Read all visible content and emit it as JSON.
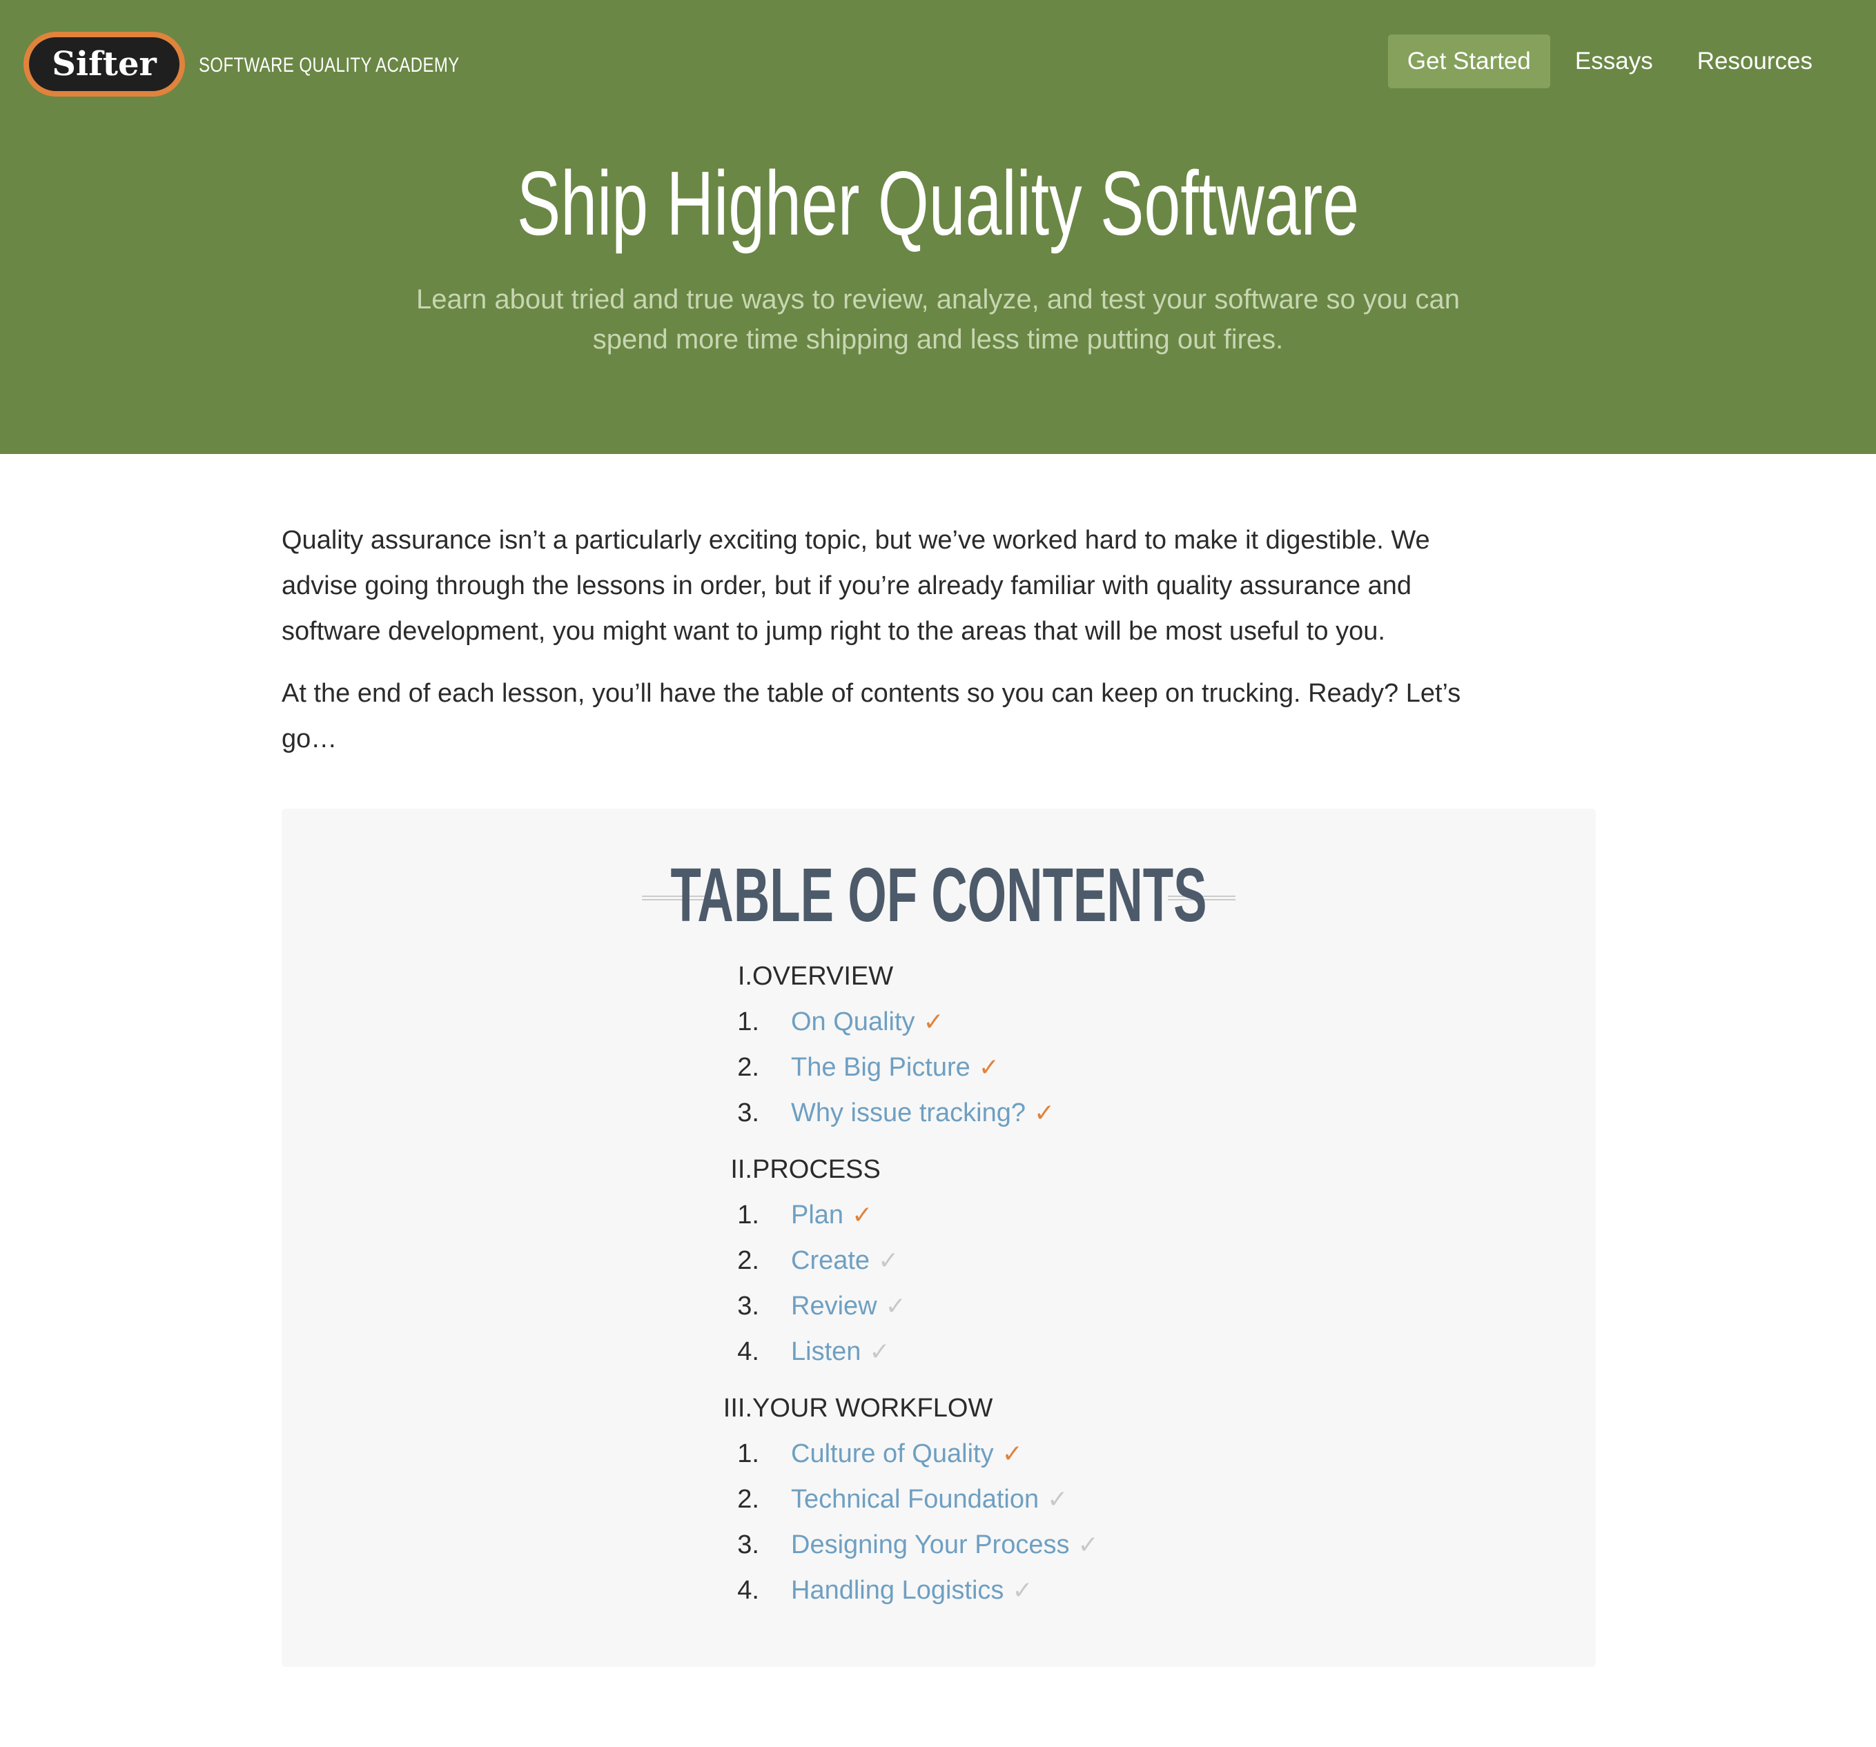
{
  "header": {
    "logo_text": "Sifter",
    "academy_text": "SOFTWARE QUALITY ACADEMY",
    "nav": [
      {
        "label": "Get Started",
        "active": true
      },
      {
        "label": "Essays",
        "active": false
      },
      {
        "label": "Resources",
        "active": false
      }
    ],
    "title": "Ship Higher Quality Software",
    "subtitle_line1": "Learn about tried and true ways to review, analyze, and test your software so you can",
    "subtitle_line2": "spend more time shipping and less time putting out fires."
  },
  "intro": {
    "para1_line1": "Quality assurance isn’t a particularly exciting topic, but we’ve worked hard to make it digestible. We",
    "para1_line2": "advise going through the lessons in order, but if you’re already familiar with quality assurance and",
    "para1_line3": "software development, you might want to jump right to the areas that will be most useful to you.",
    "para2_line1": "At the end of each lesson, you’ll have the table of contents so you can keep on trucking. Ready? Let’s",
    "para2_line2": "go…"
  },
  "toc": {
    "title": "TABLE OF CONTENTS",
    "check_glyph": "✓",
    "sections": [
      {
        "numeral": "I.",
        "title": "OVERVIEW",
        "items": [
          {
            "num": "1.",
            "label": "On Quality",
            "done": true
          },
          {
            "num": "2.",
            "label": "The Big Picture",
            "done": true
          },
          {
            "num": "3.",
            "label": "Why issue tracking?",
            "done": true
          }
        ]
      },
      {
        "numeral": "II.",
        "title": "PROCESS",
        "items": [
          {
            "num": "1.",
            "label": "Plan",
            "done": true
          },
          {
            "num": "2.",
            "label": "Create",
            "done": false
          },
          {
            "num": "3.",
            "label": "Review",
            "done": false
          },
          {
            "num": "4.",
            "label": "Listen",
            "done": false
          }
        ]
      },
      {
        "numeral": "III.",
        "title": "YOUR WORKFLOW",
        "items": [
          {
            "num": "1.",
            "label": "Culture of Quality",
            "done": true
          },
          {
            "num": "2.",
            "label": "Technical Foundation",
            "done": false
          },
          {
            "num": "3.",
            "label": "Designing Your Process",
            "done": false
          },
          {
            "num": "4.",
            "label": "Handling Logistics",
            "done": false
          }
        ]
      }
    ]
  },
  "colors": {
    "brand_green": "#6a8745",
    "nav_active": "#85a15c",
    "accent_orange": "#e0833c",
    "link_blue": "#6e9fc2"
  }
}
